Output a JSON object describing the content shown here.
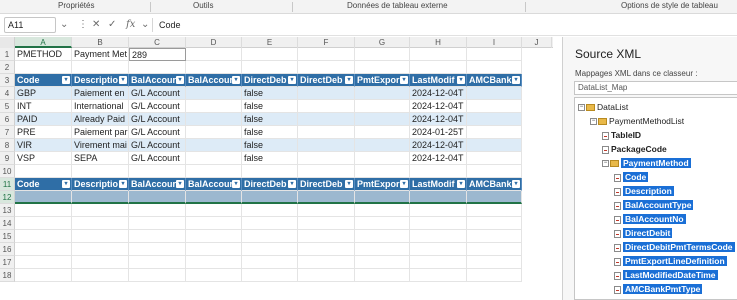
{
  "ribbon": {
    "groups": [
      "Propriétés",
      "Outils",
      "Données de tableau externe",
      "Options de style de tableau"
    ]
  },
  "formula_bar": {
    "name_box": "A11",
    "more_icon": "⋮",
    "cancel_icon": "✕",
    "enter_icon": "✓",
    "fx_label": "fx",
    "content": "Code"
  },
  "sheet": {
    "columns": [
      "A",
      "B",
      "C",
      "D",
      "E",
      "F",
      "G",
      "H",
      "I",
      "J"
    ],
    "selected_column": "A",
    "rows": [
      {
        "num": "1",
        "cells": [
          "PMETHOD",
          "Payment Met",
          "289",
          "",
          "",
          "",
          "",
          "",
          ""
        ]
      },
      {
        "num": "2",
        "cells": [
          "",
          "",
          "",
          "",
          "",
          "",
          "",
          "",
          ""
        ]
      },
      {
        "num": "3",
        "cells": [
          "Code",
          "Descriptio",
          "BalAccour",
          "BalAccour",
          "DirectDeb",
          "DirectDeb",
          "PmtExpor",
          "LastModif",
          "AMCBank"
        ]
      },
      {
        "num": "4",
        "cells": [
          "GBP",
          "Paiement en",
          "G/L Account",
          "",
          "false",
          "",
          "",
          "2024-12-04T",
          ""
        ]
      },
      {
        "num": "5",
        "cells": [
          "INT",
          "International",
          "G/L Account",
          "",
          "false",
          "",
          "",
          "2024-12-04T",
          ""
        ]
      },
      {
        "num": "6",
        "cells": [
          "PAID",
          "Already Paid",
          "G/L Account",
          "",
          "false",
          "",
          "",
          "2024-12-04T",
          ""
        ]
      },
      {
        "num": "7",
        "cells": [
          "PRE",
          "Paiement par",
          "G/L Account",
          "",
          "false",
          "",
          "",
          "2024-01-25T",
          ""
        ]
      },
      {
        "num": "8",
        "cells": [
          "VIR",
          "Virement mai",
          "G/L Account",
          "",
          "false",
          "",
          "",
          "2024-12-04T",
          ""
        ]
      },
      {
        "num": "9",
        "cells": [
          "VSP",
          "SEPA",
          "G/L Account",
          "",
          "false",
          "",
          "",
          "2024-12-04T",
          ""
        ]
      },
      {
        "num": "10",
        "cells": [
          "",
          "",
          "",
          "",
          "",
          "",
          "",
          "",
          ""
        ]
      },
      {
        "num": "11",
        "cells": [
          "Code",
          "Descriptio",
          "BalAccour",
          "BalAccour",
          "DirectDeb",
          "DirectDeb",
          "PmtExpor",
          "LastModif",
          "AMCBank"
        ]
      },
      {
        "num": "12",
        "cells": [
          "",
          "",
          "",
          "",
          "",
          "",
          "",
          "",
          ""
        ]
      },
      {
        "num": "13",
        "cells": [
          "",
          "",
          "",
          "",
          "",
          "",
          "",
          "",
          ""
        ]
      },
      {
        "num": "14",
        "cells": [
          "",
          "",
          "",
          "",
          "",
          "",
          "",
          "",
          ""
        ]
      },
      {
        "num": "15",
        "cells": [
          "",
          "",
          "",
          "",
          "",
          "",
          "",
          "",
          ""
        ]
      },
      {
        "num": "16",
        "cells": [
          "",
          "",
          "",
          "",
          "",
          "",
          "",
          "",
          ""
        ]
      },
      {
        "num": "17",
        "cells": [
          "",
          "",
          "",
          "",
          "",
          "",
          "",
          "",
          ""
        ]
      },
      {
        "num": "18",
        "cells": [
          "",
          "",
          "",
          "",
          "",
          "",
          "",
          "",
          ""
        ]
      }
    ]
  },
  "xml_source": {
    "title": "Source XML",
    "maps_label": "Mappages XML dans ce classeur :",
    "map_selected": "DataList_Map",
    "tree": [
      {
        "label": "DataList",
        "level": 0,
        "kind": "folder",
        "style": "normal"
      },
      {
        "label": "PaymentMethodList",
        "level": 1,
        "kind": "folder",
        "style": "normal"
      },
      {
        "label": "TableID",
        "level": 2,
        "kind": "leaf",
        "style": "bold"
      },
      {
        "label": "PackageCode",
        "level": 2,
        "kind": "leaf",
        "style": "bold"
      },
      {
        "label": "PaymentMethod",
        "level": 2,
        "kind": "folder",
        "style": "highlight"
      },
      {
        "label": "Code",
        "level": 3,
        "kind": "leaf",
        "style": "highlight"
      },
      {
        "label": "Description",
        "level": 3,
        "kind": "leaf",
        "style": "highlight"
      },
      {
        "label": "BalAccountType",
        "level": 3,
        "kind": "leaf",
        "style": "highlight"
      },
      {
        "label": "BalAccountNo",
        "level": 3,
        "kind": "leaf",
        "style": "highlight"
      },
      {
        "label": "DirectDebit",
        "level": 3,
        "kind": "leaf",
        "style": "highlight"
      },
      {
        "label": "DirectDebitPmtTermsCode",
        "level": 3,
        "kind": "leaf",
        "style": "highlight"
      },
      {
        "label": "PmtExportLineDefinition",
        "level": 3,
        "kind": "leaf",
        "style": "highlight"
      },
      {
        "label": "LastModifiedDateTime",
        "level": 3,
        "kind": "leaf",
        "style": "highlight"
      },
      {
        "label": "AMCBankPmtType",
        "level": 3,
        "kind": "leaf",
        "style": "highlight"
      }
    ]
  },
  "colors": {
    "table_header": "#2f6ea6",
    "band_row": "#ddebf7",
    "selection": "#217346",
    "tree_highlight": "#1a6fd6"
  }
}
